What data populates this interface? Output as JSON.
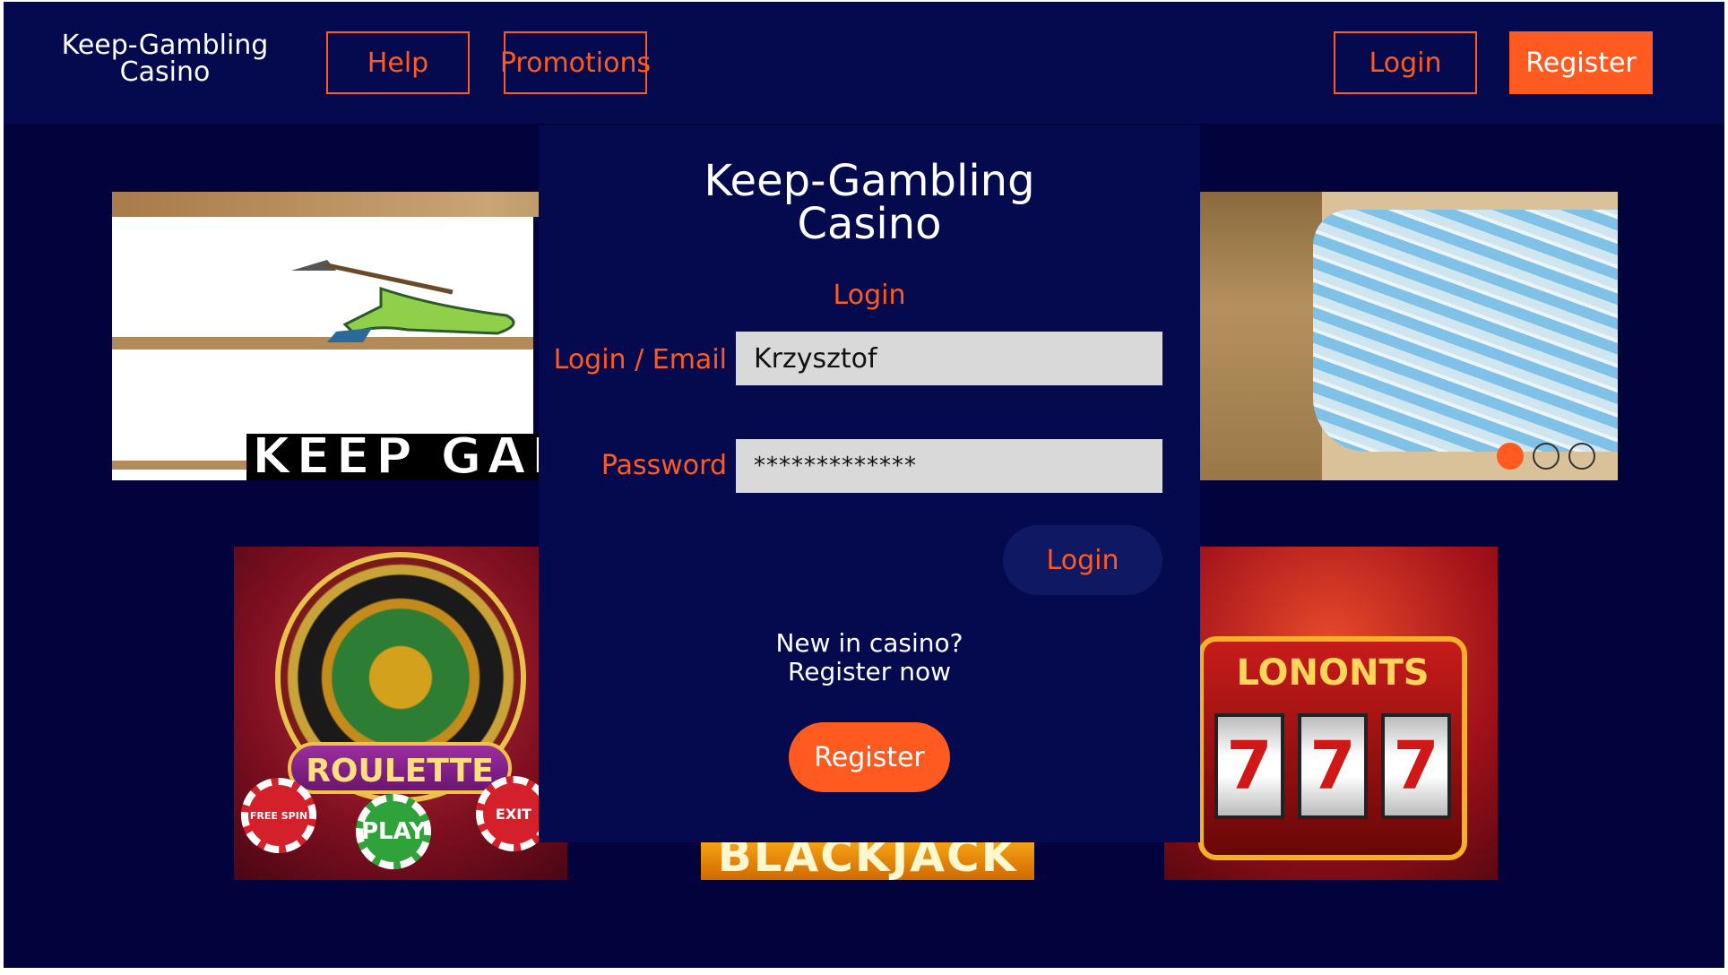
{
  "header": {
    "logo_line1": "Keep-Gambling",
    "logo_line2": "Casino",
    "nav": {
      "help": "Help",
      "promotions": "Promotions"
    },
    "login_label": "Login",
    "register_label": "Register"
  },
  "banner": {
    "text": "KEEP GAMBLING.",
    "slide_count": 3,
    "active_slide": 1
  },
  "tiles": {
    "roulette": {
      "title": "ROULETTE",
      "chip_left": "FREE SPIN",
      "chip_mid": "PLAY",
      "chip_right": "EXIT"
    },
    "blackjack": {
      "title": "BLACKJACK"
    },
    "slots": {
      "title": "LONONTS",
      "reel_symbol": "7"
    }
  },
  "modal": {
    "title_line1": "Keep-Gambling",
    "title_line2": "Casino",
    "subtitle": "Login",
    "email_label": "Login / Email",
    "email_value": "Krzysztof",
    "password_label": "Password",
    "password_value": "*************",
    "login_button": "Login",
    "new_line1": "New in casino?",
    "new_line2": "Register now",
    "register_button": "Register"
  },
  "colors": {
    "background": "#02033d",
    "header": "#040a4d",
    "accent": "#ff5a1f",
    "input_bg": "#d9d9d9"
  }
}
